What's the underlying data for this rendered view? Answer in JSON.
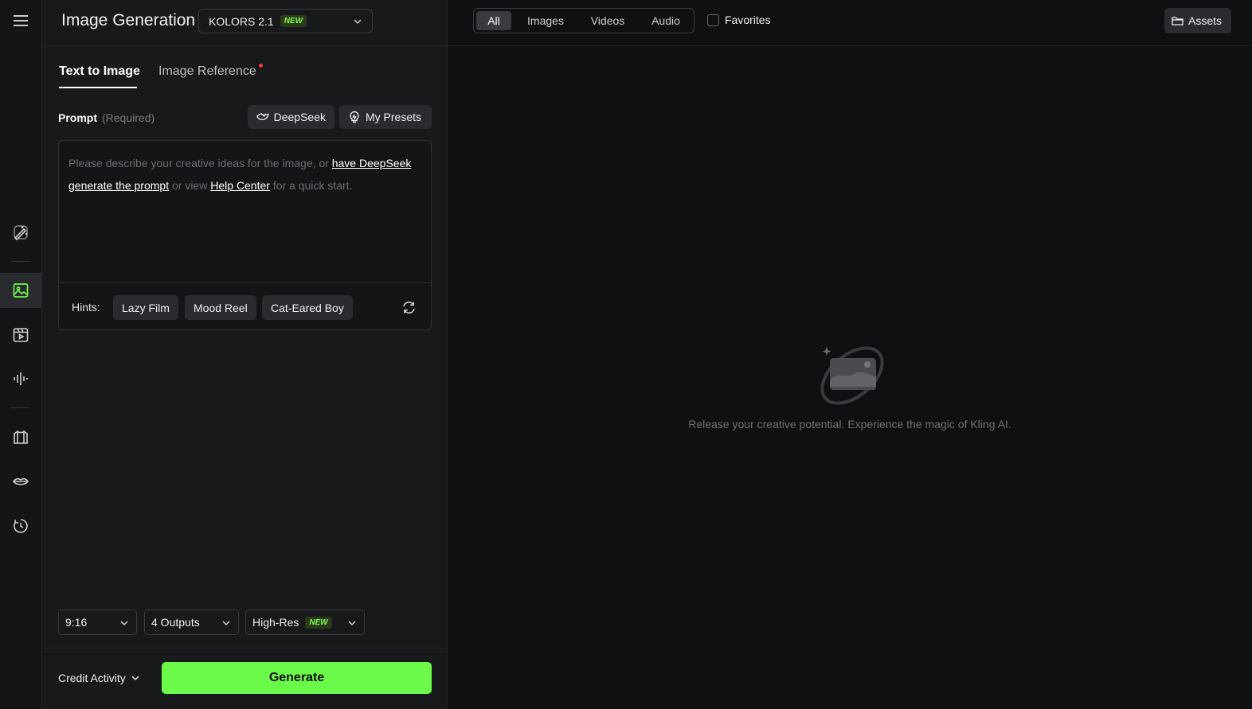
{
  "header": {
    "title": "Image Generation",
    "model": "KOLORS 2.1",
    "model_badge": "NEW"
  },
  "tabs": [
    {
      "label": "Text to Image",
      "active": true
    },
    {
      "label": "Image Reference",
      "active": false
    }
  ],
  "prompt": {
    "label": "Prompt",
    "required": "(Required)",
    "deepseek_label": "DeepSeek",
    "presets_label": "My Presets",
    "placeholder_part1": "Please describe your creative ideas for the image, or ",
    "link1": "have DeepSeek generate the prompt",
    "placeholder_part2": " or view ",
    "link2": "Help Center",
    "placeholder_part3": " for a quick start."
  },
  "hints": {
    "label": "Hints:",
    "items": [
      "Lazy Film",
      "Mood Reel",
      "Cat-Eared Boy"
    ]
  },
  "options": {
    "ratio": "9:16",
    "outputs": "4 Outputs",
    "resolution": "High-Res",
    "resolution_badge": "NEW"
  },
  "footer": {
    "credit_label": "Credit Activity",
    "generate_label": "Generate"
  },
  "filters": {
    "items": [
      "All",
      "Images",
      "Videos",
      "Audio"
    ],
    "active": "All",
    "favorites_label": "Favorites",
    "favorites_checked": false
  },
  "assets_label": "Assets",
  "empty_state": "Release your creative potential. Experience the magic of Kling AI.",
  "colors": {
    "accent": "#6cfa4a",
    "background": "#0f1011",
    "panel": "#18191b"
  },
  "rail_icons": [
    "menu-icon",
    "magic-pen-icon",
    "image-icon",
    "video-icon",
    "audio-icon",
    "shirt-icon",
    "lips-icon",
    "history-icon"
  ]
}
